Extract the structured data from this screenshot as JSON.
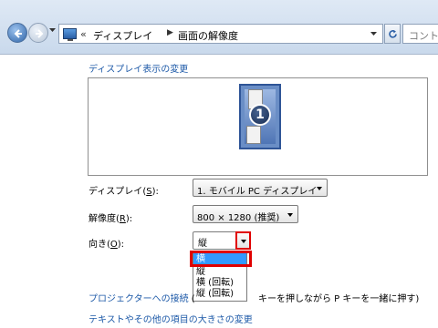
{
  "address_bar": {
    "chevron": "«",
    "breadcrumb": [
      "ディスプレイ",
      "画面の解像度"
    ],
    "search_placeholder": "コントロ"
  },
  "main": {
    "heading": "ディスプレイ表示の変更",
    "monitor_number": "1",
    "display": {
      "label": "ディスプレイ",
      "mnemonic": "S",
      "value": "1. モバイル PC ディスプレイ"
    },
    "resolution": {
      "label": "解像度",
      "mnemonic": "R",
      "value": "800 × 1280 (推奨)"
    },
    "orientation": {
      "label": "向き",
      "mnemonic": "O",
      "value": "縦",
      "options": [
        "横",
        "縦",
        "横 (回転)",
        "縦 (回転)"
      ],
      "highlighted_index": 0
    },
    "projector_link": "プロジェクターへの接続",
    "projector_hint_left": "(",
    "projector_hint_right": "キーを押しながら P キーを一緒に押す)",
    "text_size_link": "テキストやその他の項目の大きさの変更"
  },
  "colors": {
    "accent_link": "#1e5aa8",
    "highlight_box": "#e00000",
    "selection": "#3399ff"
  }
}
